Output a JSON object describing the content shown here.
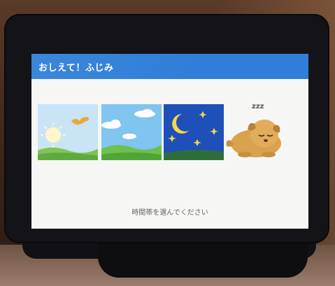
{
  "screen": {
    "title": "おしえて！ふじみ",
    "instruction": "時間帯を選んでください"
  },
  "choices": [
    {
      "name": "morning",
      "icon": "sunrise-bird-icon"
    },
    {
      "name": "day",
      "icon": "daytime-sky-icon"
    },
    {
      "name": "night",
      "icon": "night-moon-stars-icon"
    }
  ],
  "mascot": {
    "icon": "sleeping-dog-icon",
    "sleep_text": "zzz"
  },
  "colors": {
    "title_bar": "#2f7fd8",
    "screen_bg": "#f6f6f4",
    "night_sky": "#1f4fb8",
    "day_sky": "#7fc4f0",
    "morning_sky": "#bfe0f4",
    "grass": "#6cc04a"
  }
}
